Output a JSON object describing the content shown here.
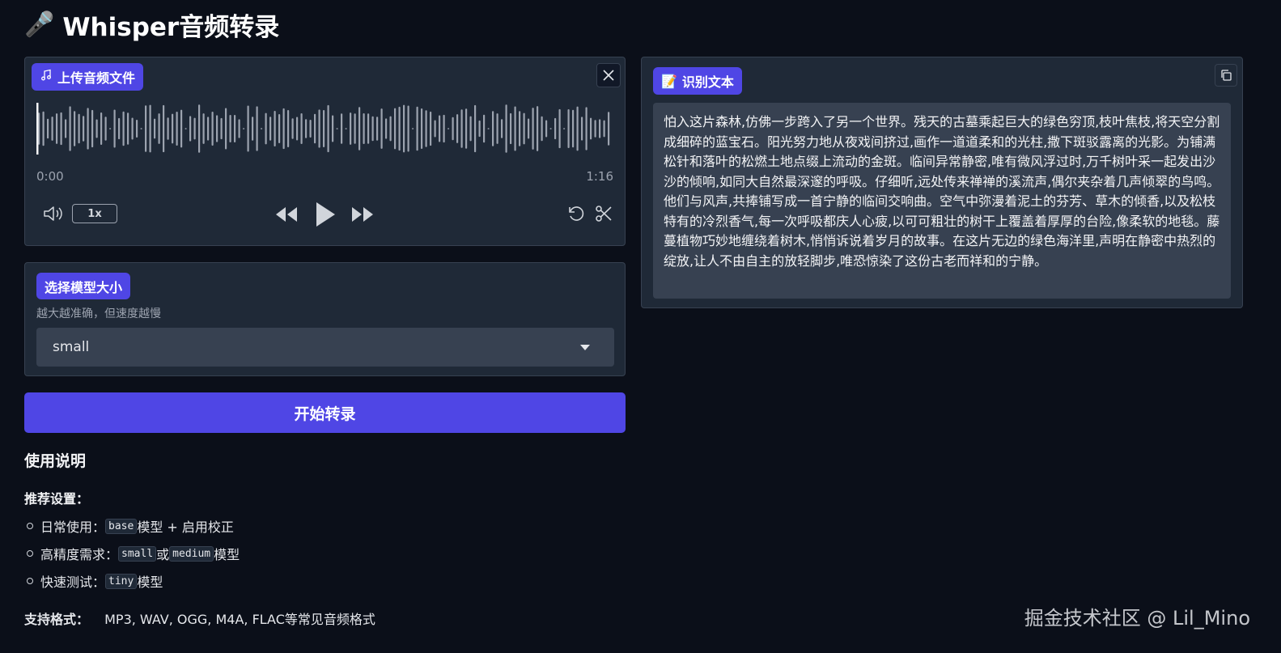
{
  "header": {
    "icon": "microphone-icon",
    "title": "Whisper音频转录"
  },
  "audio": {
    "label": "上传音频文件",
    "time_start": "0:00",
    "time_end": "1:16",
    "speed": "1x",
    "playback_progress": 0.0
  },
  "model": {
    "label": "选择模型大小",
    "info": "越大越准确，但速度越慢",
    "selected": "small"
  },
  "start_button": "开始转录",
  "instructions": {
    "title": "使用说明",
    "recommended_label": "推荐设置：",
    "items": [
      {
        "prefix": "日常使用：",
        "code1": "base",
        "mid": "",
        "code2": "",
        "suffix": "模型 + 启用校正"
      },
      {
        "prefix": "高精度需求：",
        "code1": "small",
        "mid": "或",
        "code2": "medium",
        "suffix": "模型"
      },
      {
        "prefix": "快速测试：",
        "code1": "tiny",
        "mid": "",
        "code2": "",
        "suffix": "模型"
      }
    ],
    "formats_label": "支持格式：",
    "formats_value": "MP3, WAV, OGG, M4A, FLAC等常见音频格式"
  },
  "result": {
    "label": "识别文本",
    "text": "怕入这片森林,仿佛一步跨入了另一个世界。残天的古墓乘起巨大的绿色穷顶,枝叶焦枝,将天空分割成细碎的蓝宝石。阳光努力地从夜戏间挤过,画作一道道柔和的光柱,撒下斑驳露离的光影。为铺满松针和落叶的松燃土地点缀上流动的金斑。临间异常静密,唯有微风浮过时,万千树叶采一起发出沙沙的倾响,如同大自然最深邃的呼吸。仔细听,远处传来禅禅的溪流声,偶尔夹杂着几声倾翠的鸟鸣。他们与风声,共捧铺写成一首宁静的临间交响曲。空气中弥漫着泥土的芬芳、草木的倾香,以及松枝特有的冷烈香气,每一次呼吸都庆人心疲,以可可粗壮的树干上覆盖着厚厚的台险,像柔软的地毯。藤蔓植物巧妙地缠绕着树木,悄悄诉说着岁月的故事。在这片无边的绿色海洋里,声明在静密中热烈的绽放,让人不由自主的放轻脚步,唯恐惊染了这份古老而祥和的宁静。"
  },
  "watermark": "掘金技术社区 @ Lil_Mino",
  "colors": {
    "accent": "#4f46e5",
    "background": "#0b0f19",
    "panel": "#1f2937",
    "waveform": "#9ca3af"
  }
}
